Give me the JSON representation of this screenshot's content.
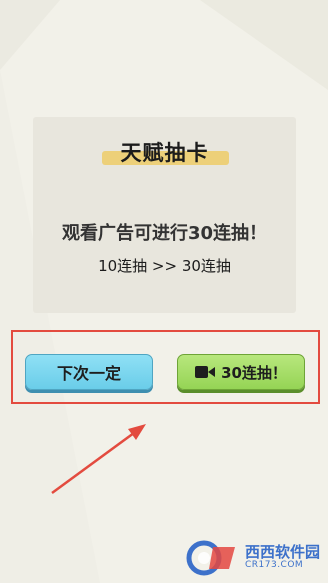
{
  "panel": {
    "title": "天赋抽卡",
    "message": "观看广告可进行30连抽！",
    "upgrade_text": "10连抽 >> 30连抽"
  },
  "buttons": {
    "next_time_label": "下次一定",
    "thirty_draw_label": "30连抽！"
  },
  "icons": {
    "video": "video-camera-icon"
  },
  "watermark": {
    "brand": "西西软件园",
    "site": "CR173.COM"
  },
  "colors": {
    "background": "#f2f1e9",
    "panel": "#e8e6dd",
    "title_highlight": "#edd079",
    "left_button": "#7fd6ef",
    "right_button": "#a4dd67",
    "annotation_red": "#e34b3f"
  }
}
